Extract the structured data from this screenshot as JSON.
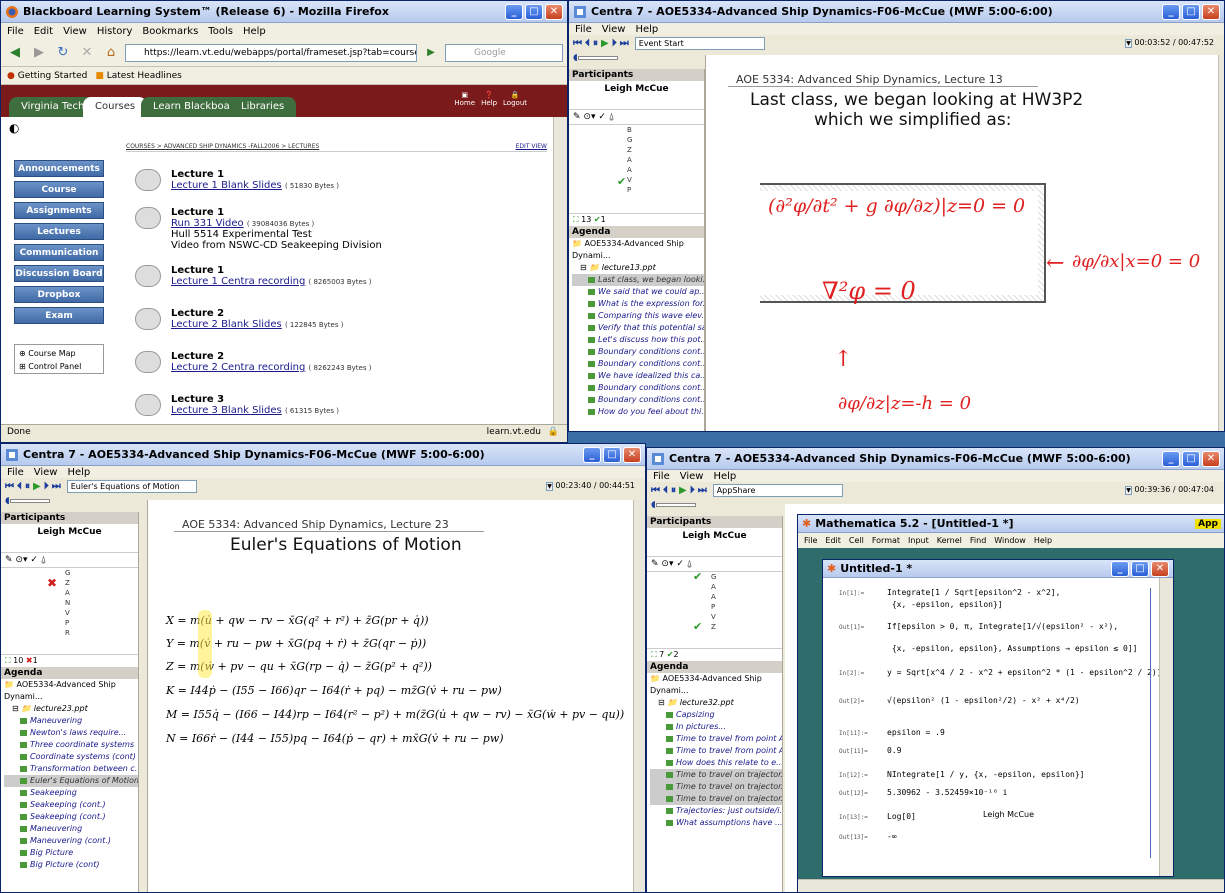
{
  "firefox": {
    "title": "Blackboard Learning System™ (Release 6) - Mozilla Firefox",
    "menu": [
      "File",
      "Edit",
      "View",
      "History",
      "Bookmarks",
      "Tools",
      "Help"
    ],
    "url": "https://learn.vt.edu/webapps/portal/frameset.jsp?tab=courses&url",
    "search_placeholder": "Google",
    "bookmarks": [
      "Getting Started",
      "Latest Headlines"
    ],
    "tabs": [
      "Virginia Tech",
      "Courses",
      "Learn Blackboard",
      "Libraries"
    ],
    "header_links": [
      "Home",
      "Help",
      "Logout"
    ],
    "breadcrumb": "COURSES > ADVANCED SHIP DYNAMICS -FALL2006 > LECTURES",
    "edit_view": "EDIT VIEW",
    "nav_buttons": [
      "Announcements",
      "Course Information",
      "Assignments",
      "Lectures",
      "Communication",
      "Discussion Board",
      "Dropbox",
      "Exam"
    ],
    "tools": [
      "Course Map",
      "Control Panel"
    ],
    "lectures": [
      {
        "title": "Lecture 1",
        "link": "Lecture 1 Blank Slides",
        "size": "( 51830 Bytes )"
      },
      {
        "title": "Lecture 1",
        "link": "Run 331 Video",
        "size": "( 39084036 Bytes )",
        "line3": "Hull 5514 Experimental Test",
        "line4": "Video from NSWC-CD Seakeeping Division"
      },
      {
        "title": "Lecture 1",
        "link": "Lecture 1 Centra recording",
        "size": "( 8265003 Bytes )"
      },
      {
        "title": "Lecture 2",
        "link": "Lecture 2 Blank Slides",
        "size": "( 122845 Bytes )"
      },
      {
        "title": "Lecture 2",
        "link": "Lecture 2 Centra recording",
        "size": "( 8262243 Bytes )"
      },
      {
        "title": "Lecture 3",
        "link": "Lecture 3 Blank Slides",
        "size": "( 61315 Bytes )"
      }
    ],
    "status_left": "Done",
    "status_right": "learn.vt.edu"
  },
  "centra_tr": {
    "title": "Centra 7 - AOE5334-Advanced Ship Dynamics-F06-McCue (MWF 5:00-6:00)",
    "menu": [
      "File",
      "View",
      "Help"
    ],
    "event": "Event Start",
    "time": "00:03:52 / 00:47:52",
    "participants_label": "Participants",
    "participant": "Leigh McCue",
    "letters": [
      "B",
      "G",
      "Z",
      "A",
      "A",
      "V",
      "P"
    ],
    "counts": "13",
    "checks": "1",
    "agenda_label": "Agenda",
    "agenda_root": "AOE5334-Advanced Ship Dynami...",
    "agenda_file": "lecture13.ppt",
    "agenda_items": [
      "Last class, we began looki...",
      "We said that we could ap...",
      "What is the expression for...",
      "Comparing this wave elev...",
      "Verify that this potential sa...",
      "Let's discuss how this pot...",
      "Boundary conditions cont...",
      "Boundary conditions cont...",
      "We have idealized this ca...",
      "Boundary conditions cont...",
      "Boundary conditions cont...",
      "How do you feel about thi..."
    ],
    "slide_header": "AOE 5334: Advanced Ship Dynamics, Lecture 13",
    "slide_line1": "Last class, we began looking at HW3P2",
    "slide_line2": "which we simplified as:",
    "hw1": "(∂²φ/∂t² + g ∂φ/∂z)|z=0 = 0",
    "hw2": "∇²φ = 0",
    "hw3": "∂φ/∂x|x=0 = 0",
    "hw4": "∂φ/∂z|z=-h = 0"
  },
  "centra_bl": {
    "title": "Centra 7 - AOE5334-Advanced Ship Dynamics-F06-McCue (MWF 5:00-6:00)",
    "menu": [
      "File",
      "View",
      "Help"
    ],
    "event": "Euler's Equations of Motion",
    "time": "00:23:40 / 00:44:51",
    "participants_label": "Participants",
    "participant": "Leigh McCue",
    "letters": [
      "G",
      "Z",
      "A",
      "N",
      "V",
      "P",
      "R"
    ],
    "counts": "10",
    "xcount": "1",
    "agenda_label": "Agenda",
    "agenda_root": "AOE5334-Advanced Ship Dynami...",
    "agenda_file": "lecture23.ppt",
    "agenda_items": [
      "Maneuvering",
      "Newton's laws require...",
      "Three coordinate systems",
      "Coordinate systems (cont)",
      "Transformation between c...",
      "Euler's Equations of Motion",
      "Seakeeping",
      "Seakeeping (cont.)",
      "Seakeeping (cont.)",
      "Maneuvering",
      "Maneuvering (cont.)",
      "Big Picture",
      "Big Picture (cont)"
    ],
    "slide_header": "AOE 5334: Advanced Ship Dynamics, Lecture 23",
    "slide_title": "Euler's Equations of Motion",
    "equations": [
      "X = m(u̇ + qw − rv − x̄G(q² + r²) + z̄G(pr + q̇))",
      "Y = m(v̇ + ru − pw + x̄G(pq + ṙ) + z̄G(qr − ṗ))",
      "Z = m(ẇ + pv − qu + x̄G(rp − q̇) − z̄G(p² + q²))",
      "K = I44ṗ − (I55 − I66)qr − I64(ṙ + pq) − mz̄G(v̇ + ru − pw)",
      "M = I55q̇ − (I66 − I44)rp − I64(r² − p²) + m(z̄G(u̇ + qw − rv) − x̄G(ẇ + pv − qu))",
      "N = I66ṙ − (I44 − I55)pq − I64(ṗ − qr) + mx̄G(v̇ + ru − pw)"
    ]
  },
  "centra_br": {
    "title": "Centra 7 - AOE5334-Advanced Ship Dynamics-F06-McCue (MWF 5:00-6:00)",
    "menu": [
      "File",
      "View",
      "Help"
    ],
    "event": "AppShare",
    "time": "00:39:36 / 00:47:04",
    "participants_label": "Participants",
    "participant": "Leigh McCue",
    "letters": [
      "G",
      "A",
      "A",
      "P",
      "V",
      "Z"
    ],
    "counts": "7",
    "checks": "2",
    "agenda_label": "Agenda",
    "agenda_root": "AOE5334-Advanced Ship Dynami...",
    "agenda_file": "lecture32.ppt",
    "agenda_items": [
      "Capsizing",
      "In pictures...",
      "Time to travel from point A...",
      "Time to travel from point A...",
      "How does this relate to e...",
      "Time to travel on trajector...",
      "Time to travel on trajector...",
      "Time to travel on trajector...",
      "Trajectories: just outside/i...",
      "What assumptions have ..."
    ],
    "math_title": "Mathematica 5.2 - [Untitled-1 *]",
    "math_menu": [
      "File",
      "Edit",
      "Cell",
      "Format",
      "Input",
      "Kernel",
      "Find",
      "Window",
      "Help"
    ],
    "nb_title": "Untitled-1 *",
    "cells": [
      {
        "lab": "In[1]:=",
        "txt": "Integrate[1 / Sqrt[epsilon^2 - x^2],"
      },
      {
        "lab": "",
        "txt": "  {x, -epsilon, epsilon}]"
      },
      {
        "lab": "Out[1]=",
        "txt": "If[epsilon > 0, π, Integrate[1/√(epsilon² - x²),"
      },
      {
        "lab": "",
        "txt": "  {x, -epsilon, epsilon}, Assumptions → epsilon ≤ 0]]"
      },
      {
        "lab": "In[2]:=",
        "txt": "y = Sqrt[x^4 / 2 - x^2 + epsilon^2 * (1 - epsilon^2 / 2)]"
      },
      {
        "lab": "Out[2]=",
        "txt": "√(epsilon² (1 - epsilon²/2) - x² + x⁴/2)"
      },
      {
        "lab": "In[11]:=",
        "txt": "epsilon = .9"
      },
      {
        "lab": "Out[11]=",
        "txt": "0.9"
      },
      {
        "lab": "In[12]:=",
        "txt": "NIntegrate[1 / y, {x, -epsilon, epsilon}]"
      },
      {
        "lab": "Out[12]=",
        "txt": "5.30962 - 3.52459×10⁻¹⁶ i"
      },
      {
        "lab": "In[13]:=",
        "txt": "Log[0]"
      },
      {
        "lab": "Out[13]=",
        "txt": "-∞"
      }
    ],
    "cursor_label": "Leigh McCue",
    "app_label": "App"
  }
}
